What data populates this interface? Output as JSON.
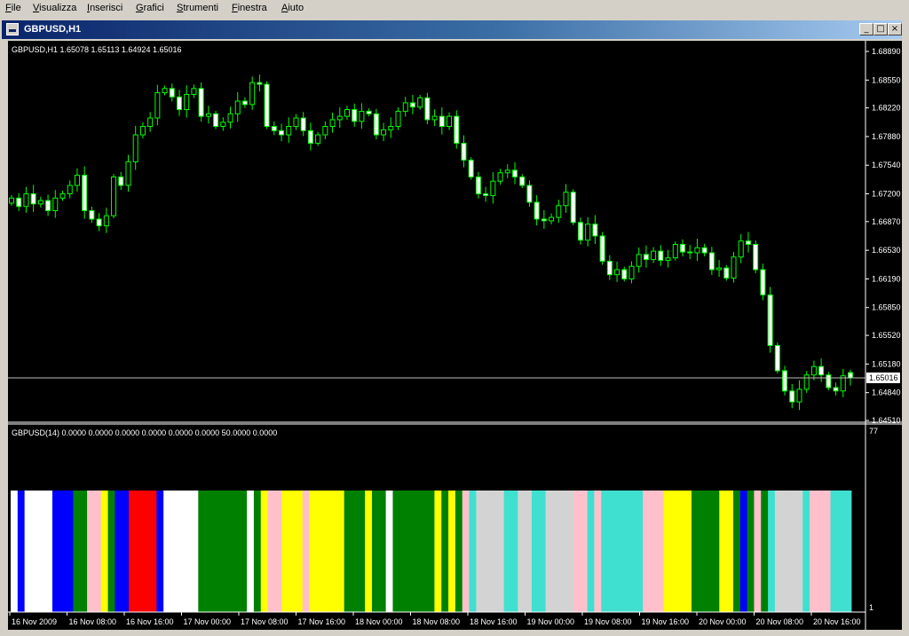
{
  "menu": [
    "File",
    "Visualizza",
    "Inserisci",
    "Grafici",
    "Strumenti",
    "Finestra",
    "Aiuto"
  ],
  "window": {
    "title": "GBPUSD,H1"
  },
  "main_chart": {
    "label": "GBPUSD,H1  1.65078 1.65113 1.64924 1.65016",
    "y_ticks": [
      "1.68890",
      "1.68550",
      "1.68220",
      "1.67880",
      "1.67540",
      "1.67200",
      "1.66870",
      "1.66530",
      "1.66190",
      "1.65850",
      "1.65520",
      "1.65180",
      "1.64840",
      "1.64510"
    ],
    "current_price": "1.65016",
    "colors": {
      "candle": "#00ff00",
      "bull_body": "#000000",
      "bear_body": "#ffffff",
      "price_line": "#c0c0c0"
    }
  },
  "indicator": {
    "label": "GBPUSD(14) 0.0000 0.0000 0.0000 0.0000 0.0000 0.0000 50.0000 0.0000",
    "scale_top": "77",
    "scale_bottom": "1"
  },
  "x_ticks": [
    "16 Nov 2009",
    "16 Nov 08:00",
    "16 Nov 16:00",
    "17 Nov 00:00",
    "17 Nov 08:00",
    "17 Nov 16:00",
    "18 Nov 00:00",
    "18 Nov 08:00",
    "18 Nov 16:00",
    "19 Nov 00:00",
    "19 Nov 08:00",
    "19 Nov 16:00",
    "20 Nov 00:00",
    "20 Nov 08:00",
    "20 Nov 16:00"
  ],
  "chart_data": {
    "type": "candlestick",
    "symbol": "GBPUSD",
    "timeframe": "H1",
    "ylim": [
      1.6451,
      1.6889
    ],
    "current_price": 1.65016,
    "last_bar": {
      "open": 1.65078,
      "high": 1.65113,
      "low": 1.64924,
      "close": 1.65016
    },
    "closes": [
      1.6715,
      1.6705,
      1.672,
      1.6708,
      1.6712,
      1.67,
      1.6715,
      1.672,
      1.673,
      1.6742,
      1.67,
      1.669,
      1.6682,
      1.6694,
      1.674,
      1.673,
      1.6758,
      1.679,
      1.68,
      1.681,
      1.684,
      1.6845,
      1.6835,
      1.682,
      1.6838,
      1.6845,
      1.6812,
      1.6815,
      1.68,
      1.6805,
      1.6815,
      1.683,
      1.6826,
      1.6852,
      1.685,
      1.68,
      1.6795,
      1.679,
      1.68,
      1.681,
      1.6795,
      1.678,
      1.679,
      1.68,
      1.6808,
      1.6812,
      1.682,
      1.6806,
      1.6818,
      1.6815,
      1.679,
      1.6796,
      1.68,
      1.6818,
      1.6828,
      1.6823,
      1.6834,
      1.6808,
      1.6812,
      1.68,
      1.6812,
      1.678,
      1.676,
      1.674,
      1.672,
      1.6718,
      1.6735,
      1.6745,
      1.6748,
      1.674,
      1.673,
      1.671,
      1.669,
      1.6688,
      1.6692,
      1.6706,
      1.6722,
      1.6686,
      1.6665,
      1.6684,
      1.667,
      1.664,
      1.6624,
      1.663,
      1.6619,
      1.6634,
      1.6648,
      1.6642,
      1.6652,
      1.6641,
      1.6644,
      1.666,
      1.6651,
      1.665,
      1.6656,
      1.665,
      1.663,
      1.6632,
      1.662,
      1.6645,
      1.6664,
      1.666,
      1.663,
      1.66,
      1.654,
      1.651,
      1.6486,
      1.6473,
      1.6488,
      1.6505,
      1.6515,
      1.6505,
      1.649,
      1.6486,
      1.6504,
      1.65016
    ]
  },
  "indicator_data": {
    "type": "color-histogram",
    "palette": {
      "white": "#ffffff",
      "blue": "#0000ff",
      "green": "#008000",
      "pink": "#ffc0cb",
      "yellow": "#ffff00",
      "red": "#ff0000",
      "gray": "#d3d3d3",
      "cyan": "#40e0d0"
    },
    "bars": [
      "white",
      "blue",
      "white",
      "white",
      "white",
      "white",
      "blue",
      "blue",
      "blue",
      "green",
      "green",
      "pink",
      "pink",
      "yellow",
      "green",
      "blue",
      "blue",
      "red",
      "red",
      "red",
      "red",
      "blue",
      "white",
      "white",
      "white",
      "white",
      "white",
      "green",
      "green",
      "green",
      "green",
      "green",
      "green",
      "green",
      "white",
      "green",
      "yellow",
      "pink",
      "pink",
      "yellow",
      "yellow",
      "yellow",
      "pink",
      "yellow",
      "yellow",
      "yellow",
      "yellow",
      "yellow",
      "green",
      "green",
      "green",
      "yellow",
      "green",
      "green",
      "white",
      "green",
      "green",
      "green",
      "green",
      "green",
      "green",
      "yellow",
      "green",
      "yellow",
      "green",
      "pink",
      "cyan",
      "gray",
      "gray",
      "gray",
      "gray",
      "cyan",
      "cyan",
      "gray",
      "gray",
      "cyan",
      "cyan",
      "gray",
      "gray",
      "gray",
      "gray",
      "pink",
      "pink",
      "cyan",
      "pink",
      "cyan",
      "cyan",
      "cyan",
      "cyan",
      "cyan",
      "cyan",
      "pink",
      "pink",
      "pink",
      "yellow",
      "yellow",
      "yellow",
      "yellow",
      "green",
      "green",
      "green",
      "green",
      "yellow",
      "yellow",
      "green",
      "blue",
      "green",
      "pink",
      "green",
      "cyan",
      "gray",
      "gray",
      "gray",
      "gray",
      "cyan",
      "pink",
      "pink",
      "pink",
      "cyan",
      "cyan",
      "cyan"
    ]
  }
}
